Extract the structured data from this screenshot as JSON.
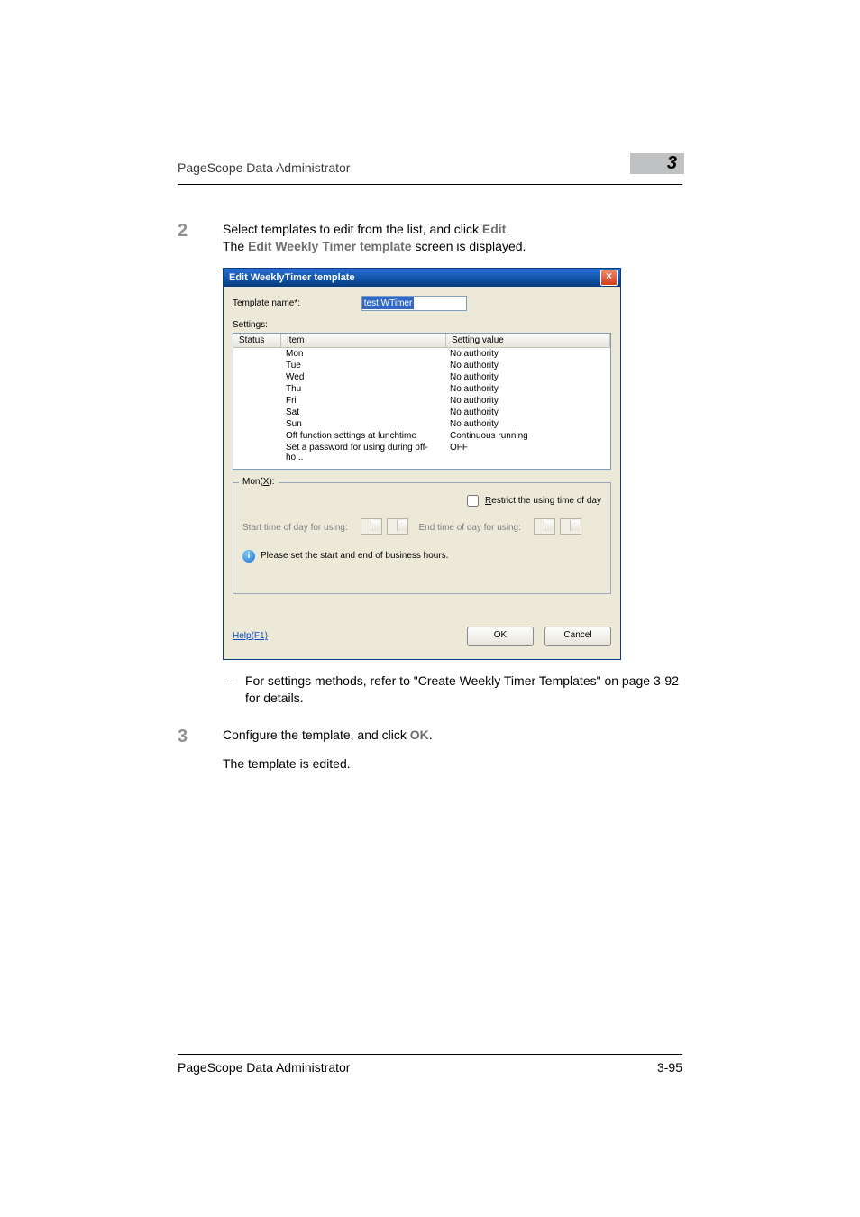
{
  "header": {
    "title": "PageScope Data Administrator",
    "chapter": "3"
  },
  "step2": {
    "num": "2",
    "line1_pre": "Select templates to edit from the list, and click ",
    "edit": "Edit",
    "line1_post": ".",
    "line2_pre": "The ",
    "bold": "Edit Weekly Timer template",
    "line2_post": " screen is displayed."
  },
  "dialog": {
    "title": "Edit WeeklyTimer template",
    "template_name_label_pre": "T",
    "template_name_label_rest": "emplate name*:",
    "template_name_value": "test WTimer",
    "settings_label_pre": "S",
    "settings_label_rest": "ettings:",
    "cols": {
      "status": "Status",
      "item": "Item",
      "value": "Setting value"
    },
    "rows": [
      {
        "item": "Mon",
        "value": "No authority"
      },
      {
        "item": "Tue",
        "value": "No authority"
      },
      {
        "item": "Wed",
        "value": "No authority"
      },
      {
        "item": "Thu",
        "value": "No authority"
      },
      {
        "item": "Fri",
        "value": "No authority"
      },
      {
        "item": "Sat",
        "value": "No authority"
      },
      {
        "item": "Sun",
        "value": "No authority"
      },
      {
        "item": "Off function settings at lunchtime",
        "value": "Continuous running"
      },
      {
        "item": "Set a password for using during off-ho...",
        "value": "OFF"
      }
    ],
    "group_legend_pre": "Mon(",
    "group_legend_ul": "X",
    "group_legend_post": "):",
    "restrict_pre": "R",
    "restrict_rest": "estrict the using time of day",
    "start_label": "Start time of day for using:",
    "end_label_pre": "E",
    "end_label_rest": "nd time of day for using:",
    "hint": "Please set the start and end of business hours.",
    "help": "Help(F1)",
    "ok": "OK",
    "cancel": "Cancel"
  },
  "note": "For settings methods, refer to \"Create Weekly Timer Templates\" on page 3-92 for details.",
  "step3": {
    "num": "3",
    "line1_pre": "Configure the template, and click ",
    "ok": "OK",
    "line1_post": ".",
    "line2": "The template is edited."
  },
  "footer": {
    "title": "PageScope Data Administrator",
    "page": "3-95"
  }
}
